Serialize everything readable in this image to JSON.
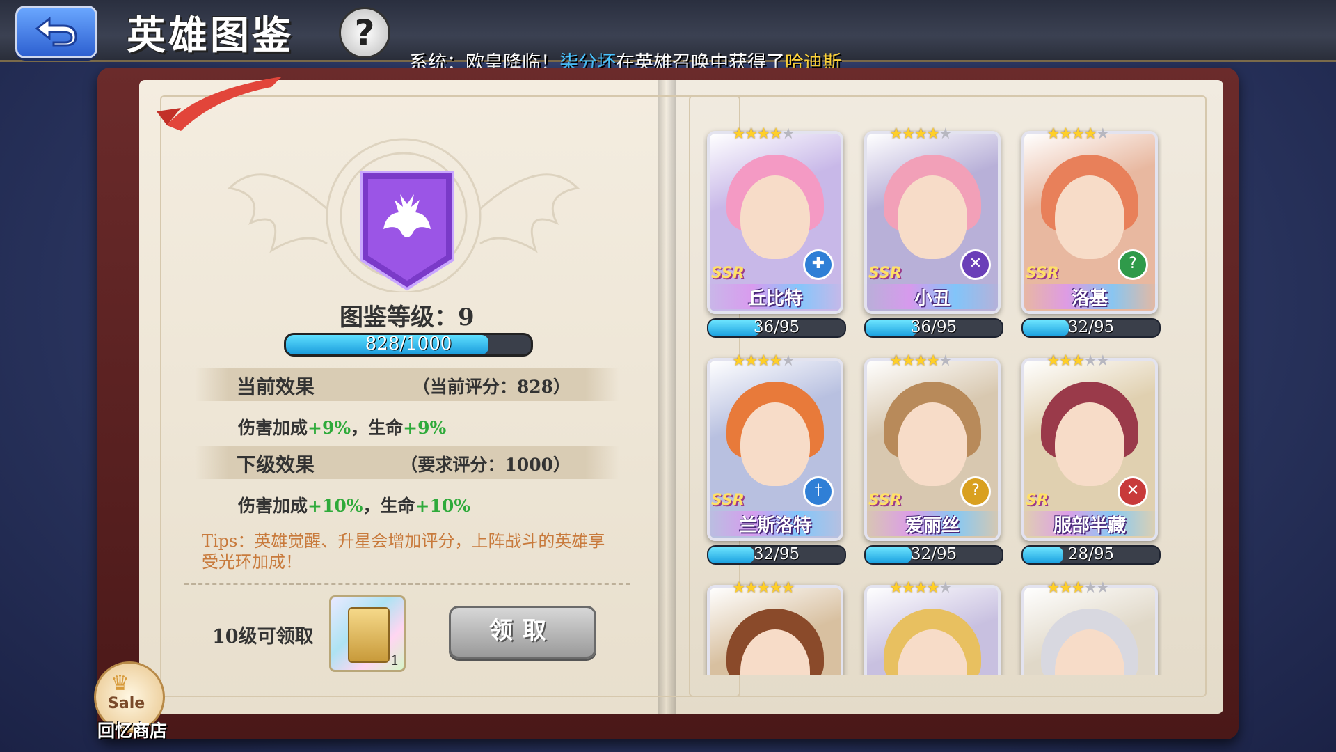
{
  "header": {
    "title": "英雄图鉴",
    "help_label": "?",
    "ticker": {
      "prefix": "系统：欧皇降临！",
      "player": "柒分坏",
      "middle": "在英雄召唤中获得了",
      "hero": "哈迪斯"
    }
  },
  "collection": {
    "level_label": "图鉴等级：",
    "level": "9",
    "xp_text": "828/1000",
    "xp_progress": 0.828
  },
  "current_effect": {
    "title": "当前效果",
    "score": "（当前评分：828）",
    "text_a": "伤害加成",
    "val_a": "+9%",
    "sep": "，生命",
    "val_b": "+9%"
  },
  "next_effect": {
    "title": "下级效果",
    "score": "（要求评分：1000）",
    "text_a": "伤害加成",
    "val_a": "+10%",
    "sep": "，生命",
    "val_b": "+10%"
  },
  "tips": "Tips：英雄觉醒、升星会增加评分，上阵战斗的英雄享受光环加成！",
  "reward": {
    "label": "10级可领取",
    "count": "1",
    "claim_label": "领取"
  },
  "shop": {
    "sale": "Sale",
    "label": "回忆商店"
  },
  "heroes": [
    {
      "name": "丘比特",
      "rarity": "SSR",
      "stars": 4,
      "progress": "36/95",
      "ratio": 0.379,
      "class_icon": "cross-icon",
      "class_color": "#2f7fd6",
      "bg": "#c8b8e8",
      "hair": "#f49ac4"
    },
    {
      "name": "小丑",
      "rarity": "SSR",
      "stars": 4,
      "progress": "36/95",
      "ratio": 0.379,
      "class_icon": "swords-icon",
      "class_color": "#6a3fb8",
      "bg": "#b8b0d8",
      "hair": "#f2a0b8"
    },
    {
      "name": "洛基",
      "rarity": "SSR",
      "stars": 4,
      "progress": "32/95",
      "ratio": 0.337,
      "class_icon": "question-icon",
      "class_color": "#2f9a4a",
      "bg": "#e8b8a0",
      "hair": "#e8805a"
    },
    {
      "name": "兰斯洛特",
      "rarity": "SSR",
      "stars": 4,
      "progress": "32/95",
      "ratio": 0.337,
      "class_icon": "sword-icon",
      "class_color": "#2f7fd6",
      "bg": "#b8c0e0",
      "hair": "#e87a3a"
    },
    {
      "name": "爱丽丝",
      "rarity": "SSR",
      "stars": 4,
      "progress": "32/95",
      "ratio": 0.337,
      "class_icon": "question-icon",
      "class_color": "#d9a020",
      "bg": "#d8c8b0",
      "hair": "#b88a5a"
    },
    {
      "name": "服部半藏",
      "rarity": "SR",
      "stars": 3,
      "progress": "28/95",
      "ratio": 0.295,
      "class_icon": "swords-icon",
      "class_color": "#c83a3a",
      "bg": "#e0d0b0",
      "hair": "#9a3a4a"
    },
    {
      "name": "",
      "rarity": "",
      "stars": 5,
      "progress": "",
      "ratio": 0,
      "class_icon": "",
      "class_color": "#888",
      "bg": "#d8c0a0",
      "hair": "#8a4a2a"
    },
    {
      "name": "",
      "rarity": "",
      "stars": 4,
      "progress": "",
      "ratio": 0,
      "class_icon": "",
      "class_color": "#888",
      "bg": "#c8c0e0",
      "hair": "#e8c060"
    },
    {
      "name": "",
      "rarity": "",
      "stars": 3,
      "progress": "",
      "ratio": 0,
      "class_icon": "",
      "class_color": "#888",
      "bg": "#e0d8c8",
      "hair": "#d8d8e0"
    }
  ]
}
